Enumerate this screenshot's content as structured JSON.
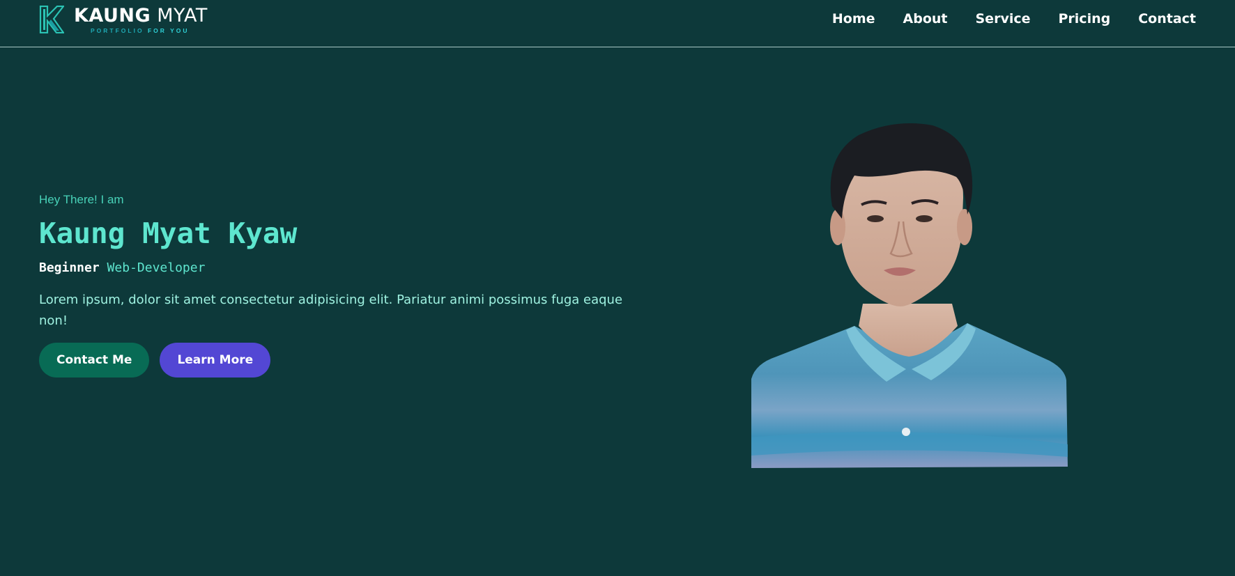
{
  "nav": {
    "brand": {
      "mark": "K",
      "name_bold": "KAUNG",
      "name_light": "MYAT",
      "tag_a": "PORTFOLIO",
      "tag_b": "FOR YOU"
    },
    "links": [
      "Home",
      "About",
      "Service",
      "Pricing",
      "Contact"
    ]
  },
  "hero": {
    "greeting": "Hey There! I am",
    "name": "Kaung Myat Kyaw",
    "role_a": "Beginner",
    "role_b": "Web-Developer",
    "description": "Lorem ipsum, dolor sit amet consectetur adipisicing elit. Pariatur animi possimus fuga eaque non!",
    "buttons": {
      "contact": "Contact Me",
      "learn": "Learn More"
    }
  },
  "colors": {
    "background": "#0d393a",
    "accent": "#5ee6cf",
    "contact_button": "#086b55",
    "learn_button": "#5347d4"
  },
  "icons": [
    "k-logo-icon"
  ]
}
